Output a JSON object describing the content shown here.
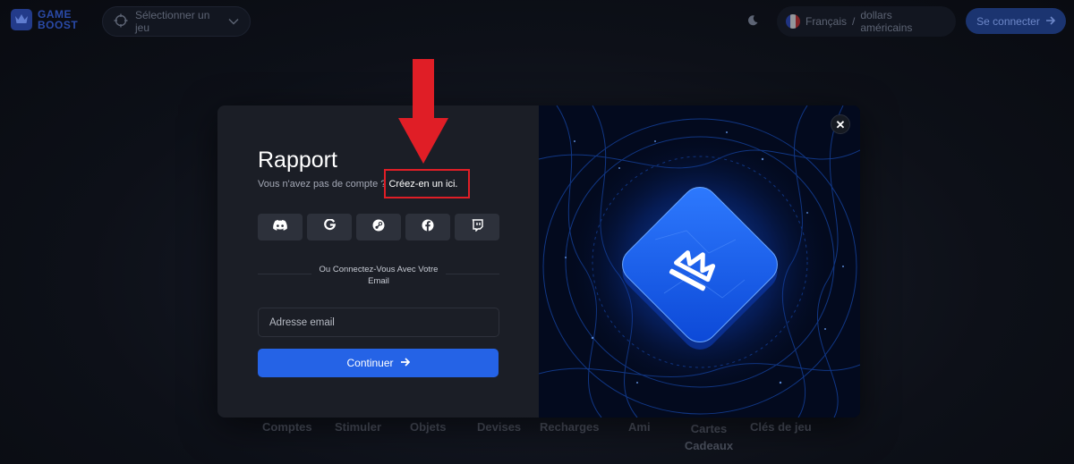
{
  "header": {
    "logo_line1": "GAME",
    "logo_line2": "BOOST",
    "game_select_label": "Sélectionner un jeu",
    "language": "Français",
    "separator": "/",
    "currency": "dollars américains",
    "login_label": "Se connecter"
  },
  "modal": {
    "title": "Rapport",
    "subtitle_text": "Vous n'avez pas de compte ?",
    "create_link": "Créez-en un ici.",
    "social_buttons": [
      "discord-icon",
      "google-icon",
      "steam-icon",
      "facebook-icon",
      "twitch-icon"
    ],
    "divider_text": "Ou Connectez-Vous Avec Votre Email",
    "email_placeholder": "Adresse email",
    "continue_label": "Continuer",
    "close_symbol": "✕"
  },
  "bottom_nav": [
    "Comptes",
    "Stimuler",
    "Objets",
    "Devises",
    "Recharges",
    "Ami",
    "Cartes Cadeaux",
    "Clés de jeu"
  ],
  "annotation": {
    "arrow_color": "#e01e26",
    "box_color": "#e01e26"
  },
  "colors": {
    "accent": "#2563e6",
    "modal_bg": "#1b1e26"
  }
}
